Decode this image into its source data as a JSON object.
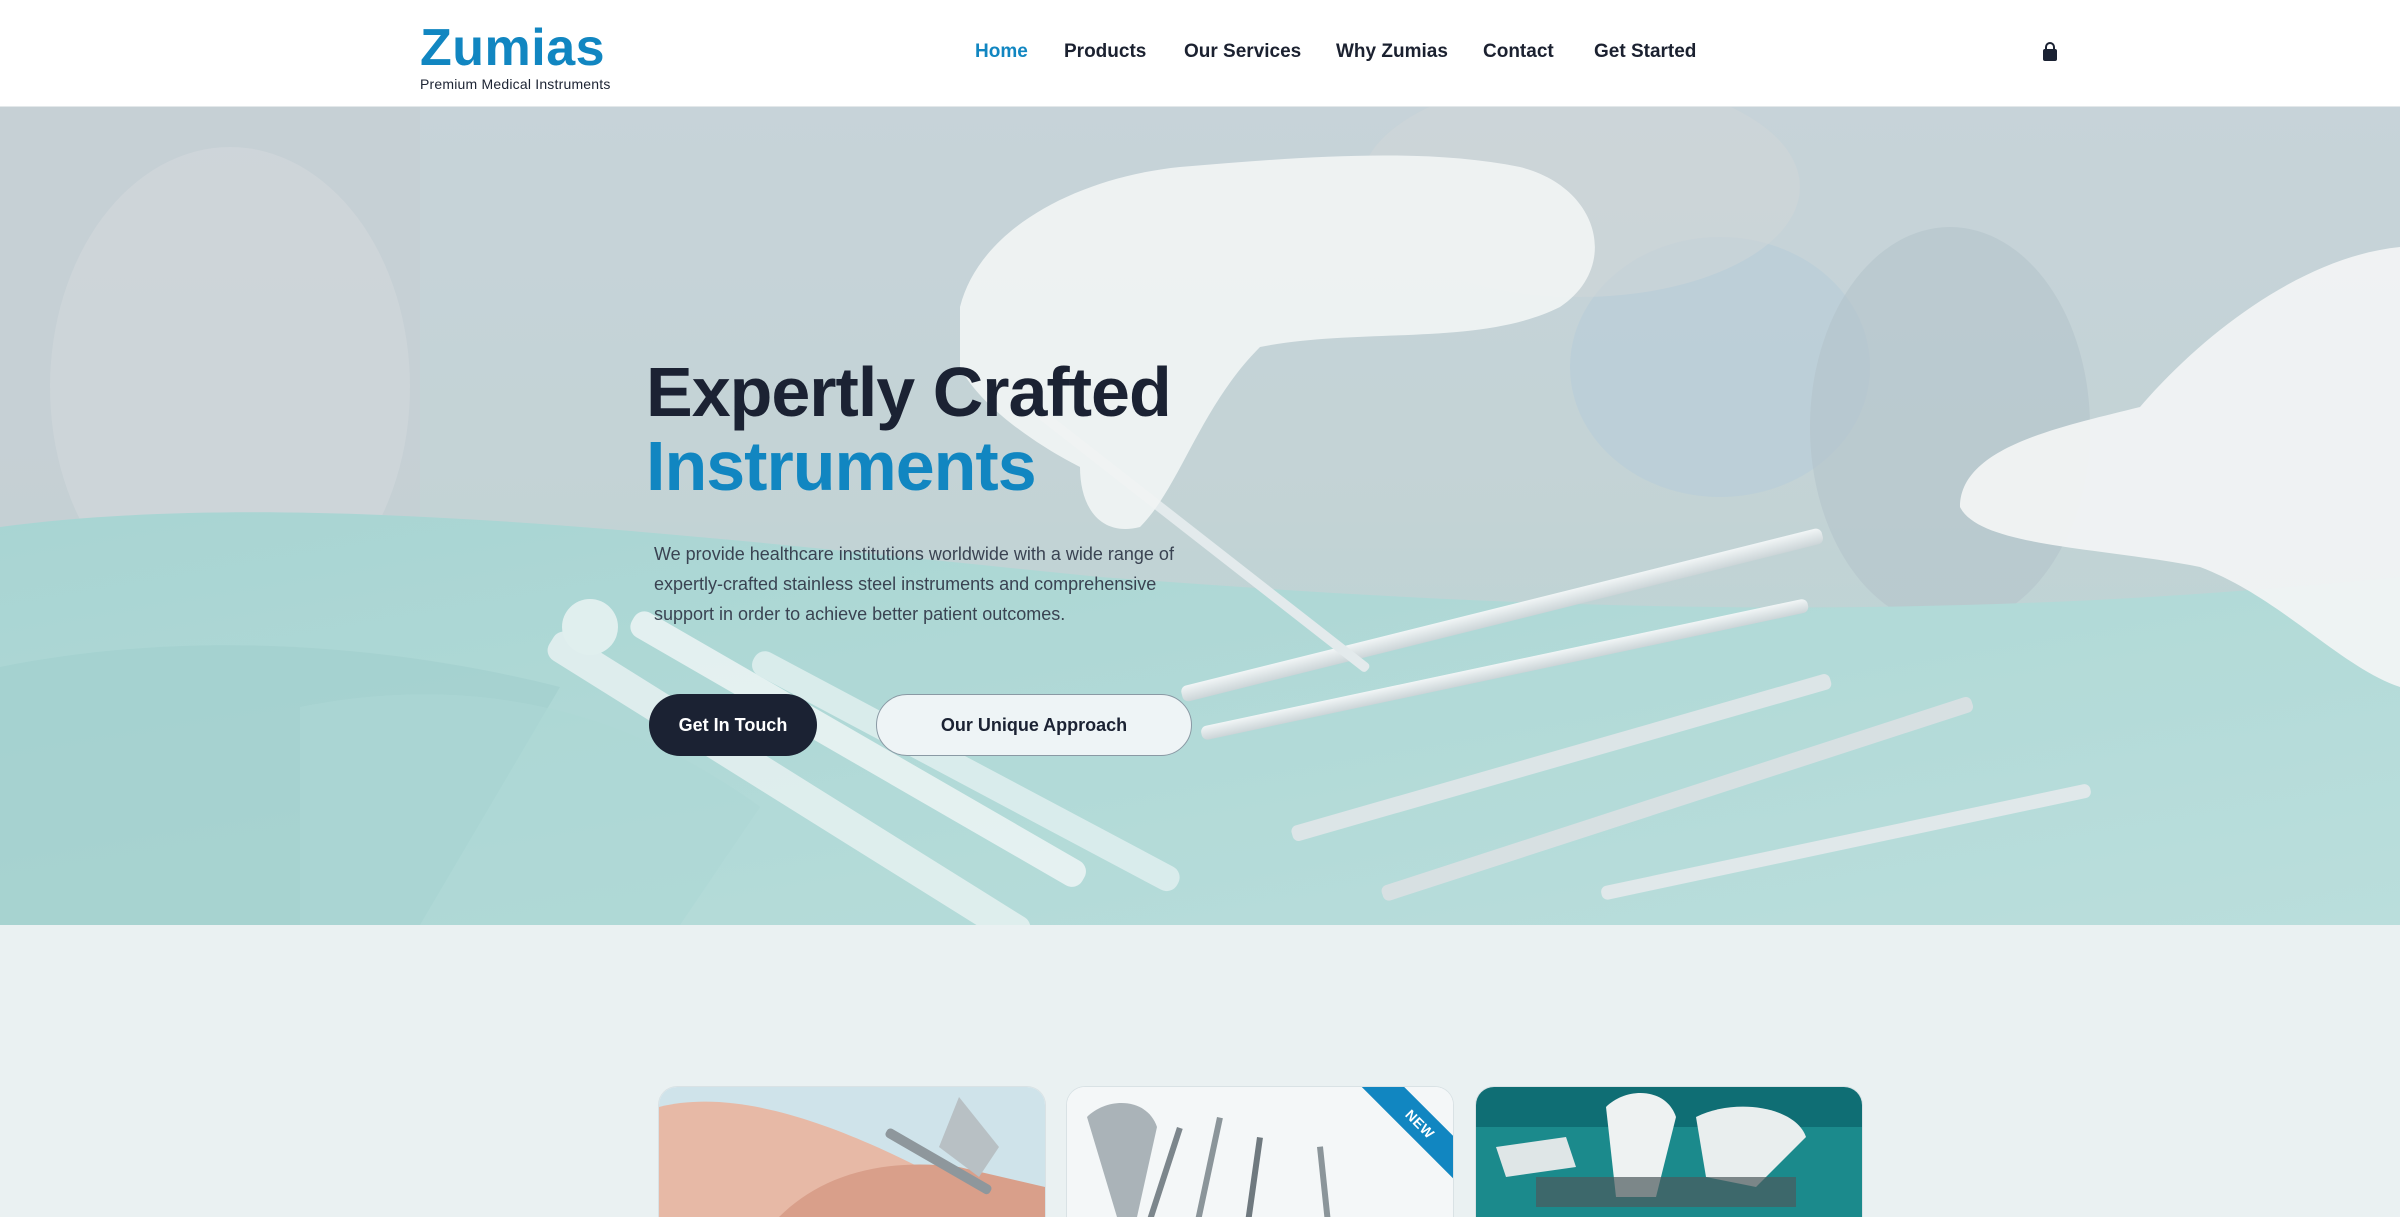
{
  "brand": {
    "name": "Zumias",
    "tagline": "Premium Medical Instruments",
    "accent": "#1186c1",
    "dark": "#1b2233"
  },
  "nav": {
    "items": [
      {
        "label": "Home",
        "active": true
      },
      {
        "label": "Products",
        "active": false
      },
      {
        "label": "Our Services",
        "active": false
      },
      {
        "label": "Why Zumias",
        "active": false
      },
      {
        "label": "Contact",
        "active": false
      },
      {
        "label": "Get Started",
        "active": false
      }
    ],
    "cart_icon": "shopping-bag-icon"
  },
  "hero": {
    "title_line1": "Expertly Crafted",
    "title_line2": "Instruments",
    "description": "We provide healthcare institutions worldwide with a wide range of expertly-crafted stainless steel instruments and comprehensive support in order to achieve better patient outcomes.",
    "primary_button": "Get In Touch",
    "secondary_button": "Our Unique Approach"
  },
  "cards": [
    {
      "image": "nail-clipper-photo",
      "badge": ""
    },
    {
      "image": "dental-instruments-photo",
      "badge": "NEW"
    },
    {
      "image": "surgery-team-photo",
      "badge": ""
    }
  ]
}
